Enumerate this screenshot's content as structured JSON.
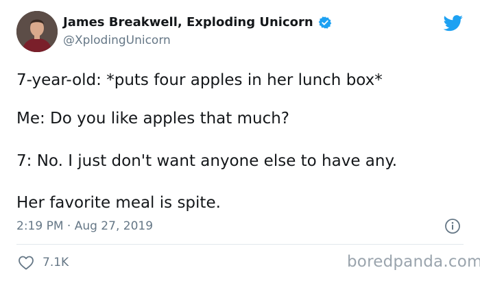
{
  "author": {
    "display_name": "James Breakwell, Exploding Unicorn",
    "handle": "@XplodingUnicorn",
    "avatar_icon": "user-avatar",
    "verified_icon": "verified-badge-icon"
  },
  "brand": {
    "logo_icon": "twitter-bird-icon",
    "accent_color": "#1da1f2"
  },
  "tweet": {
    "lines": [
      "7-year-old: *puts four apples in her lunch box*",
      "Me: Do you like apples that much?",
      "7: No. I just don't want anyone else to have any.",
      "Her favorite meal is spite."
    ],
    "timestamp": "2:19 PM · Aug 27, 2019",
    "info_icon": "info-icon"
  },
  "actions": {
    "like_icon": "heart-icon",
    "like_count": "7.1K"
  },
  "watermark": {
    "text": "boredpanda.com"
  }
}
